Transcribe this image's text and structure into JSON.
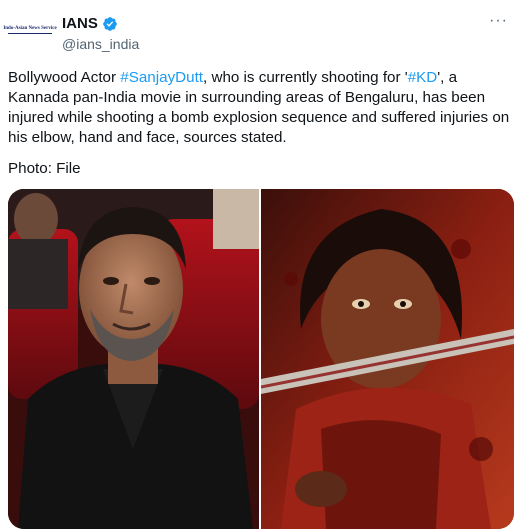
{
  "account": {
    "name": "IANS",
    "handle": "@ians_india",
    "avatar_text": "Indo-Asian News Service",
    "avatar_icon": "ians-logo",
    "verified_icon": "verified-badge-icon",
    "more_icon": "more-options-icon",
    "more_glyph": "···"
  },
  "tweet": {
    "text_segments": [
      {
        "text": "Bollywood Actor ",
        "link": false
      },
      {
        "text": "#SanjayDutt",
        "link": true
      },
      {
        "text": ", who is currently shooting for '",
        "link": false
      },
      {
        "text": "#KD",
        "link": true
      },
      {
        "text": "', a Kannada pan-India movie in surrounding areas of Bengaluru, has been injured while shooting a bomb explosion sequence and suffered injuries on his elbow, hand and face, sources stated.",
        "link": false
      }
    ],
    "photo_credit": "Photo: File"
  },
  "colors": {
    "link": "#1d9bf0",
    "verified": "#1d9bf0",
    "secondary_text": "#536471"
  }
}
